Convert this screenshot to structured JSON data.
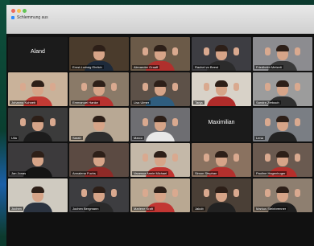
{
  "window": {
    "title": "Schlemmung aus"
  },
  "participants": [
    {
      "name": "Aland",
      "plain": true,
      "bg": "#1b1b1b",
      "shirt": "#1b1b1b",
      "hands": false
    },
    {
      "name": "Ernst-Ludwig Ehrlich",
      "bg": "#4a3b2c",
      "shirt": "#1e2a3a",
      "hands": false
    },
    {
      "name": "Alexander Graaff",
      "bg": "#6b5a48",
      "shirt": "#b0302d",
      "hands": true
    },
    {
      "name": "Rachel vo Beest",
      "bg": "#3d3d42",
      "shirt": "#2b2b2b",
      "hands": true
    },
    {
      "name": "Friedhelm Metzelt",
      "bg": "#8c8c90",
      "shirt": "#3a3a3a",
      "hands": true
    },
    {
      "name": "Johanna Kuhneh",
      "bg": "#c9b29a",
      "shirt": "#c23a34",
      "hands": true
    },
    {
      "name": "Emmanuel Hanke",
      "bg": "#8a7a68",
      "shirt": "#b8322f",
      "hands": true
    },
    {
      "name": "Lisa Ulmer",
      "bg": "#5d5148",
      "shirt": "#2f5d7e",
      "hands": true
    },
    {
      "name": "Tanja",
      "bg": "#d8d2c8",
      "shirt": "#b02c2a",
      "hands": true
    },
    {
      "name": "Sandra Zerbach",
      "bg": "#9c9c9c",
      "shirt": "#2f2f2f",
      "hands": true
    },
    {
      "name": "Ulla",
      "bg": "#3b3b3b",
      "shirt": "#1c1c1c",
      "hands": true
    },
    {
      "name": "Sarah",
      "bg": "#b8a894",
      "shirt": "#2e2e2e",
      "hands": false
    },
    {
      "name": "Marco",
      "bg": "#6e6e72",
      "shirt": "#e8e8e8",
      "hands": true
    },
    {
      "name": "Maximilian",
      "plain": true,
      "bg": "#1b1b1b",
      "shirt": "#1b1b1b",
      "hands": false
    },
    {
      "name": "Lena",
      "bg": "#7a7e84",
      "shirt": "#232323",
      "hands": true
    },
    {
      "name": "Jan Jonas",
      "bg": "#3c3a3c",
      "shirt": "#141414",
      "hands": false
    },
    {
      "name": "Annalena Fuchs",
      "bg": "#5b4a42",
      "shirt": "#8e2a27",
      "hands": false
    },
    {
      "name": "Vanessa Annie Michael",
      "bg": "#c4b8a8",
      "shirt": "#c03330",
      "hands": true
    },
    {
      "name": "Simon Stephan",
      "bg": "#8a7260",
      "shirt": "#b3302d",
      "hands": true
    },
    {
      "name": "Pauline Hagenbuger",
      "bg": "#6a5a50",
      "shirt": "#b62f2c",
      "hands": true
    },
    {
      "name": "Jochen",
      "bg": "#cfcac0",
      "shirt": "#2b3340",
      "hands": false
    },
    {
      "name": "Jochen Bergmann",
      "bg": "#3d3d40",
      "shirt": "#2a2a2a",
      "hands": true
    },
    {
      "name": "Marlene Kraft",
      "bg": "#b9a892",
      "shirt": "#c23633",
      "hands": true
    },
    {
      "name": "Jakob",
      "bg": "#4a3f36",
      "shirt": "#222",
      "hands": true
    },
    {
      "name": "Markus Steinbrenner",
      "bg": "#8e7f70",
      "shirt": "#1f1f1f",
      "hands": true
    }
  ]
}
